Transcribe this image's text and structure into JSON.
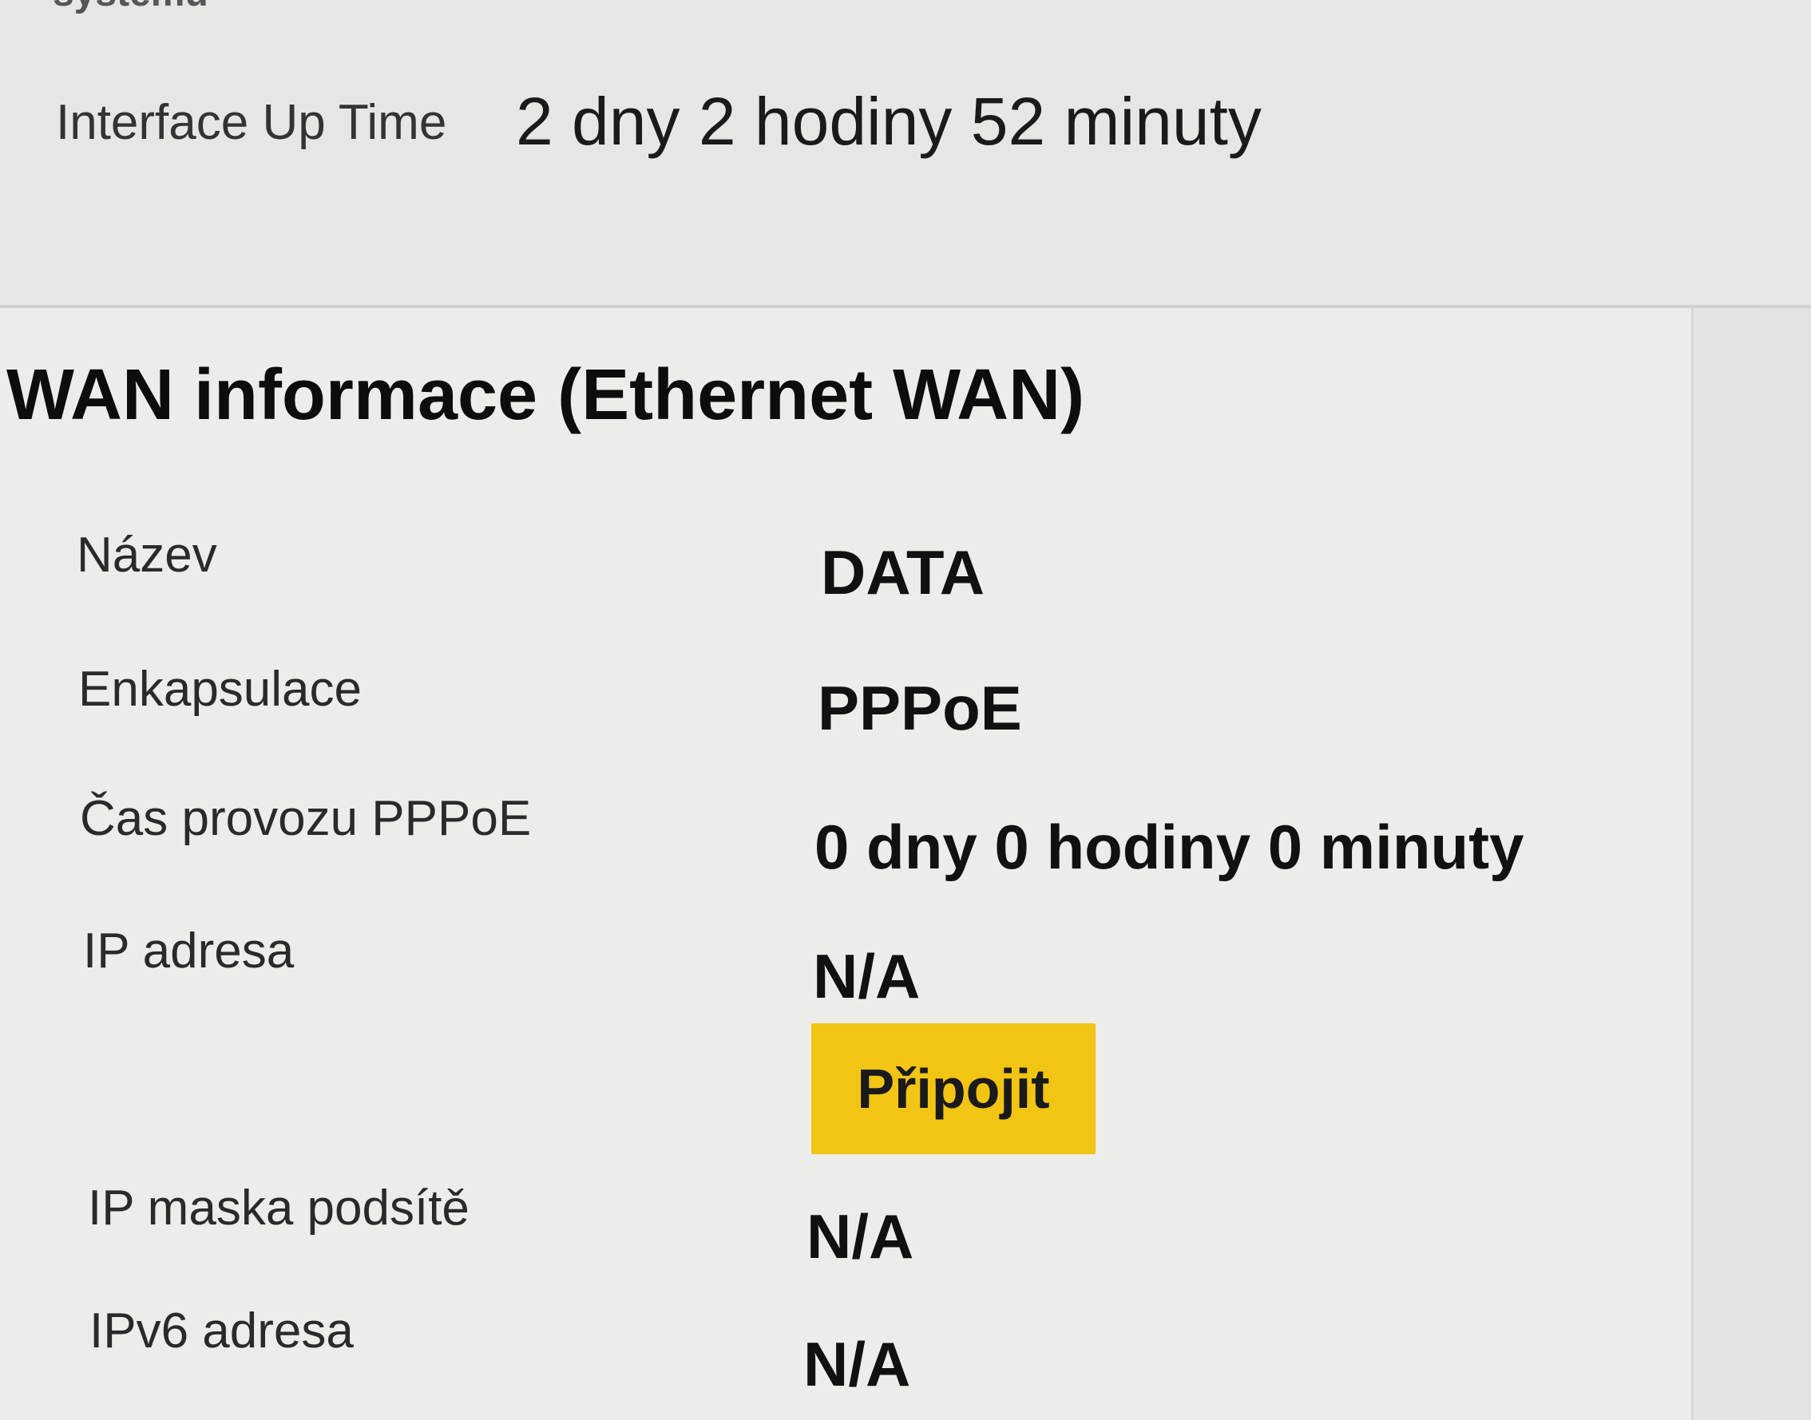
{
  "system_section": {
    "title_fragment": "systému",
    "uptime_label": "Interface Up Time",
    "uptime_value": "2 dny 2 hodiny 52 minuty"
  },
  "wan_section": {
    "title": "WAN informace (Ethernet WAN)",
    "rows": [
      {
        "label": "Název",
        "value": "DATA"
      },
      {
        "label": "Enkapsulace",
        "value": "PPPoE"
      },
      {
        "label": "Čas provozu PPPoE",
        "value": "0 dny 0 hodiny 0 minuty"
      },
      {
        "label": "IP adresa",
        "value": "N/A"
      },
      {
        "label": "IP maska podsítě",
        "value": "N/A"
      },
      {
        "label": "IPv6 adresa",
        "value": "N/A"
      }
    ],
    "connect_button_label": "Připojit",
    "accent_color": "#f2c414"
  }
}
